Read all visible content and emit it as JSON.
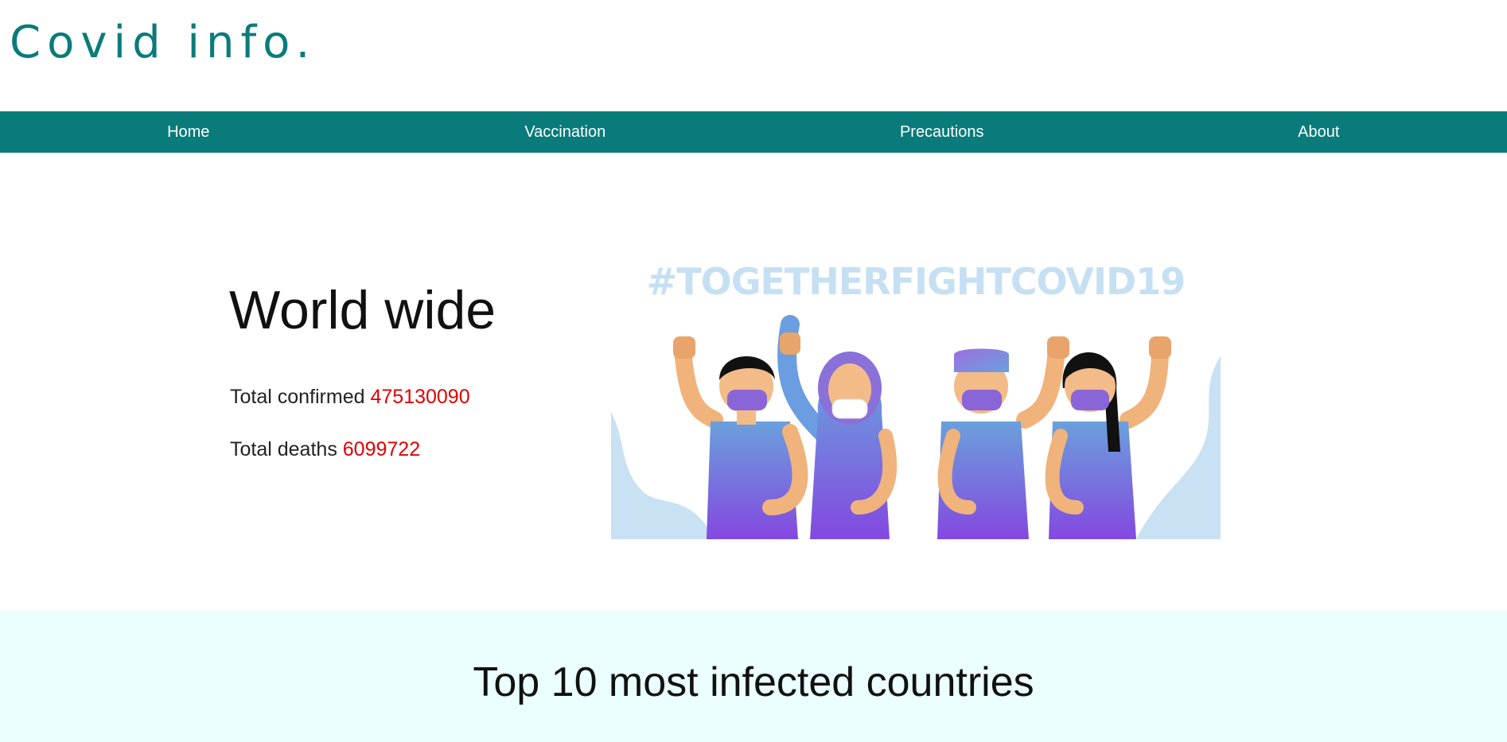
{
  "brand": {
    "title": "Covid info."
  },
  "nav": {
    "items": [
      {
        "label": "Home"
      },
      {
        "label": "Vaccination"
      },
      {
        "label": "Precautions"
      },
      {
        "label": "About"
      }
    ]
  },
  "hero": {
    "title": "World wide",
    "confirmed_label": "Total confirmed",
    "confirmed_value": "475130090",
    "deaths_label": "Total deaths",
    "deaths_value": "6099722",
    "banner_text": "#TOGETHERFIGHTCOVID19"
  },
  "section": {
    "title": "Top 10 most infected countries"
  },
  "colors": {
    "brand": "#0a7b7b",
    "stat_value": "#e00000",
    "section_bg": "#eafffe"
  }
}
